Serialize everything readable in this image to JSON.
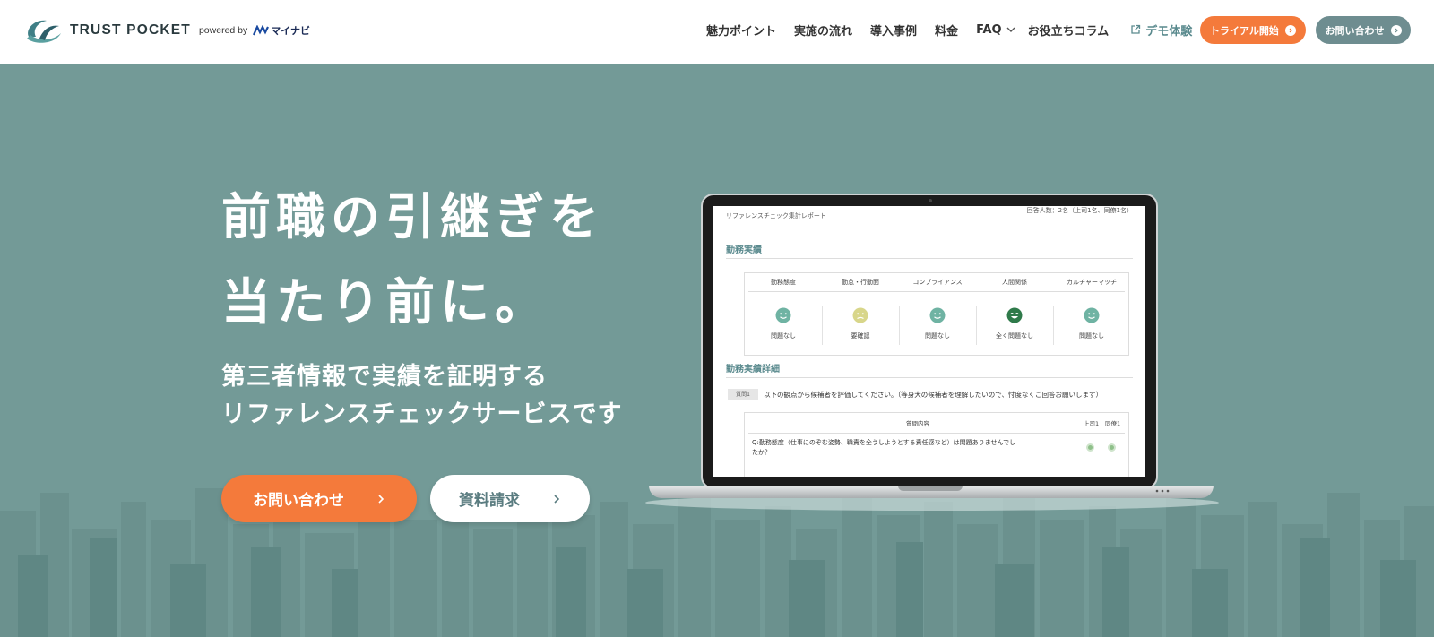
{
  "header": {
    "logo_text": "TRUST POCKET",
    "powered_by": "powered by",
    "partner": "マイナビ",
    "nav": [
      "魅力ポイント",
      "実施の流れ",
      "導入事例",
      "料金",
      "FAQ",
      "お役立ちコラム"
    ],
    "demo_link": "デモ体験",
    "trial_button": "トライアル開始",
    "contact_button": "お問い合わせ"
  },
  "hero": {
    "headline_line1": "前職の引継ぎを",
    "headline_line2": "当たり前に。",
    "sub_line1": "第三者情報で実績を証明する",
    "sub_line2": "リファレンスチェックサービスです",
    "cta_contact": "お問い合わせ",
    "cta_docs": "資料請求"
  },
  "report": {
    "report_title": "リファレンスチェック集計レポート",
    "respondents": "回答人数：2名（上司1名、同僚1名）",
    "section_performance": "勤務実績",
    "categories": [
      "勤務態度",
      "勤怠・行動面",
      "コンプライアンス",
      "人間関係",
      "カルチャーマッチ"
    ],
    "results": [
      "問題なし",
      "要確認",
      "問題なし",
      "全く問題なし",
      "問題なし"
    ],
    "section_detail": "勤務実績詳細",
    "q_tag": "質問1",
    "q_text": "以下の観点から候補者を評価してください。（等身大の候補者を理解したいので、忖度なくご回答お願いします）",
    "table_head_content": "質問内容",
    "table_head_boss": "上司1",
    "table_head_peer": "同僚1",
    "row1_line1": "Q:勤務態度（仕事にのぞむ姿勢、職責を全うしようとする責任感など）は問題ありませんでし",
    "row1_line2": "たか？"
  },
  "colors": {
    "brand_teal": "#739a97",
    "accent_orange": "#f47a3b",
    "contact_gray": "#6e8d90",
    "face_ok": "#6fb3a3",
    "face_warn": "#d8d68a",
    "face_great": "#2f7a4a"
  },
  "icons": {
    "demo": "external-link-icon",
    "faq": "chevron-down-icon",
    "button": "arrow-circle-right-icon"
  }
}
